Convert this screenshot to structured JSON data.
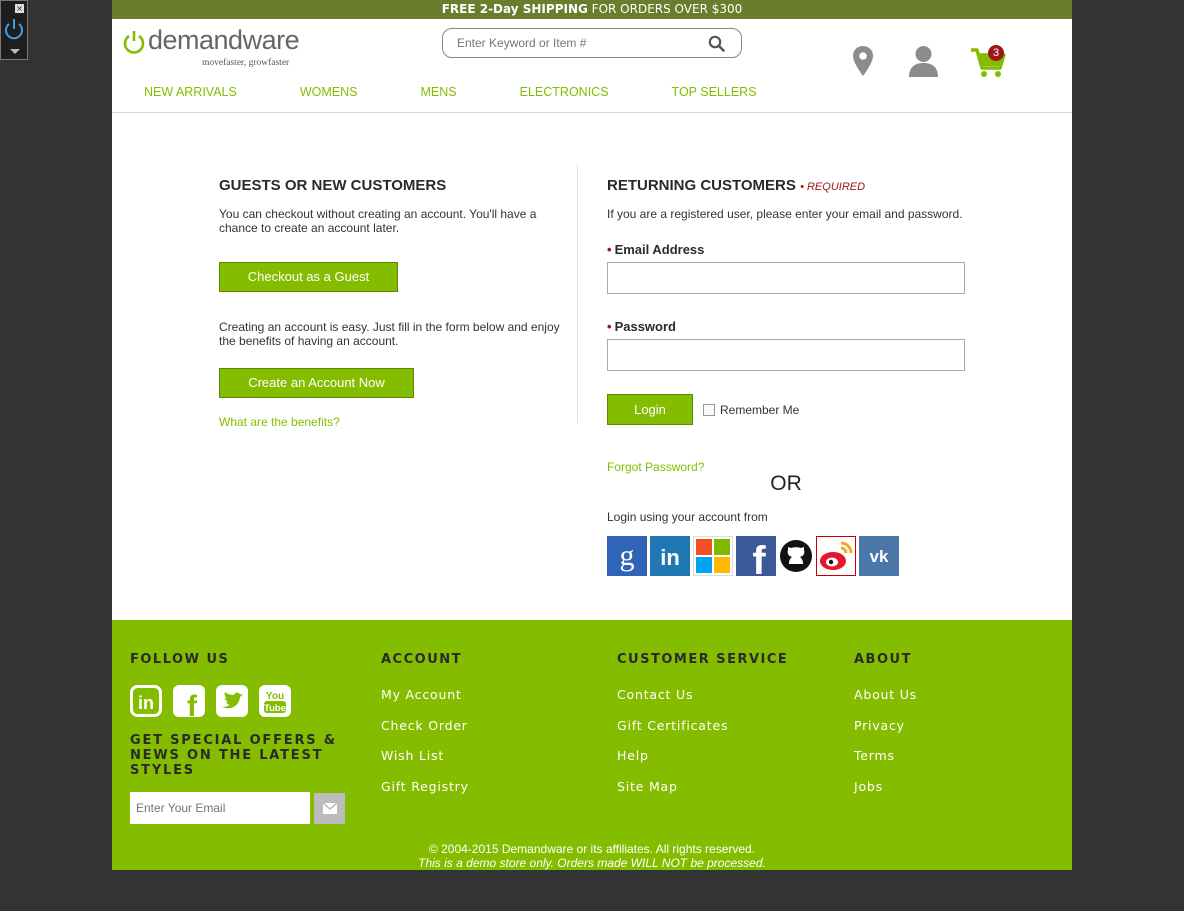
{
  "promo": {
    "bold_text": "FREE 2-Day SHIPPING",
    "rest_text": " FOR ORDERS OVER $300"
  },
  "brand": {
    "name_part1": "demand",
    "name_part2": "ware",
    "tagline": "movefaster, growfaster"
  },
  "search": {
    "placeholder": "Enter Keyword or Item #"
  },
  "cart": {
    "count": "3"
  },
  "nav": {
    "items": [
      "NEW ARRIVALS",
      "WOMENS",
      "MENS",
      "ELECTRONICS",
      "TOP SELLERS"
    ]
  },
  "guests": {
    "title": "GUESTS OR NEW CUSTOMERS",
    "intro": "You can checkout without creating an account. You'll have a chance to create an account later.",
    "guest_button": "Checkout as a Guest",
    "create_intro": "Creating an account is easy. Just fill in the form below and enjoy the benefits of having an account.",
    "create_button": "Create an Account Now",
    "benefits_link": "What are the benefits?"
  },
  "returning": {
    "title": "RETURNING CUSTOMERS",
    "required": "• REQUIRED",
    "intro": "If you are a registered user, please enter your email and password.",
    "email_label": "Email Address",
    "password_label": "Password",
    "login_button": "Login",
    "remember_label": "Remember Me",
    "forgot_link": "Forgot Password?",
    "or_text": "OR",
    "oauth_text": "Login using your account from",
    "providers": [
      "google-icon",
      "linkedin-icon",
      "microsoft-icon",
      "facebook-icon",
      "github-icon",
      "weibo-icon",
      "vk-icon"
    ]
  },
  "footer": {
    "follow_title": "FOLLOW US",
    "offers_title": "GET SPECIAL OFFERS & NEWS ON THE LATEST STYLES",
    "email_placeholder": "Enter Your Email",
    "account": {
      "title": "ACCOUNT",
      "links": [
        "My Account",
        "Check Order",
        "Wish List",
        "Gift Registry"
      ]
    },
    "service": {
      "title": "CUSTOMER SERVICE",
      "links": [
        "Contact Us",
        "Gift Certificates",
        "Help",
        "Site Map"
      ]
    },
    "about": {
      "title": "ABOUT",
      "links": [
        "About Us",
        "Privacy",
        "Terms",
        "Jobs"
      ]
    },
    "copyright": "© 2004-2015 Demandware or its affiliates. All rights reserved.",
    "demo_notice": "This is a demo store only. Orders made WILL NOT be processed."
  },
  "colors": {
    "accent": "#84bd00",
    "banner": "#6b7d2c",
    "required": "#a01616",
    "background": "#333333"
  }
}
